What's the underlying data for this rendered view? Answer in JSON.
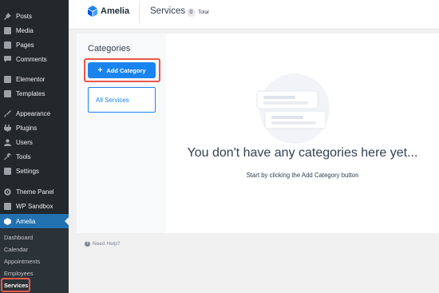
{
  "sidebar": {
    "items": [
      {
        "label": "Posts",
        "icon": "pin-icon"
      },
      {
        "label": "Media",
        "icon": "media-icon"
      },
      {
        "label": "Pages",
        "icon": "pages-icon"
      },
      {
        "label": "Comments",
        "icon": "comments-icon"
      },
      {
        "label": "Elementor",
        "icon": "elementor-icon"
      },
      {
        "label": "Templates",
        "icon": "templates-icon"
      },
      {
        "label": "Appearance",
        "icon": "brush-icon"
      },
      {
        "label": "Plugins",
        "icon": "plugin-icon"
      },
      {
        "label": "Users",
        "icon": "user-icon"
      },
      {
        "label": "Tools",
        "icon": "wrench-icon"
      },
      {
        "label": "Settings",
        "icon": "settings-icon"
      },
      {
        "label": "Theme Panel",
        "icon": "gear-icon"
      },
      {
        "label": "WP Sandbox",
        "icon": "sandbox-icon"
      },
      {
        "label": "Amelia",
        "icon": "amelia-icon"
      }
    ],
    "submenu": [
      {
        "label": "Dashboard"
      },
      {
        "label": "Calendar"
      },
      {
        "label": "Appointments"
      },
      {
        "label": "Employees"
      },
      {
        "label": "Services"
      }
    ]
  },
  "header": {
    "logo_text": "Amelia",
    "page_title": "Services",
    "count": "0",
    "count_label": "Total"
  },
  "categories": {
    "title": "Categories",
    "add_button": "Add Category",
    "add_button_icon": "plus-icon",
    "all_services": "All Services"
  },
  "empty_state": {
    "title": "You don't have any categories here yet...",
    "subtitle": "Start by clicking the Add Category button"
  },
  "footer": {
    "help": "Need Help?"
  },
  "colors": {
    "sidebar_bg": "#23282d",
    "active_bg": "#2271b1",
    "accent": "#1a84ee",
    "highlight": "#e8584a"
  }
}
